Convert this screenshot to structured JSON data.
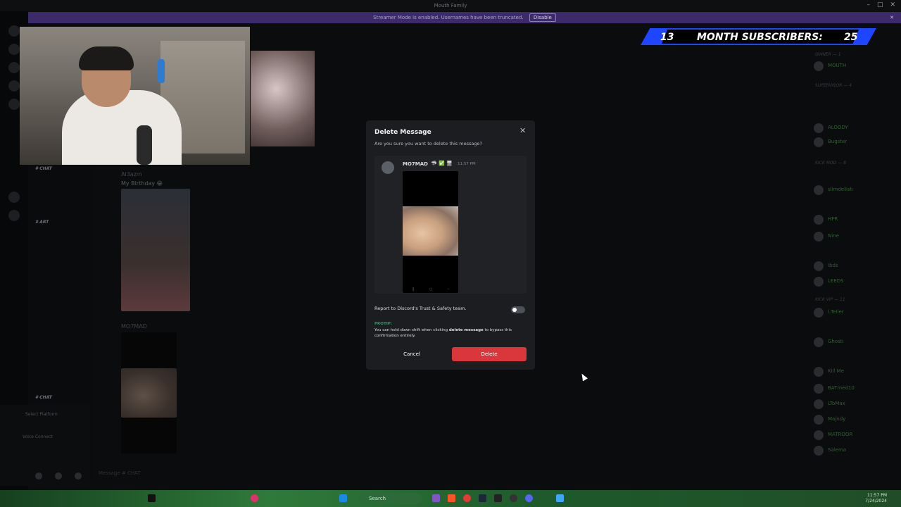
{
  "window": {
    "title": "Mouth Family"
  },
  "banner": {
    "text": "Streamer Mode is enabled. Usernames have been truncated.",
    "disable_label": "Disable",
    "close": "✕"
  },
  "overlay": {
    "left_number": "13",
    "label": "MONTH SUBSCRIBERS:",
    "right_number": "25"
  },
  "channels": [
    {
      "name": "CHAT"
    },
    {
      "name": "ART"
    },
    {
      "name": "CHAT"
    }
  ],
  "chat": {
    "msg1_author": "Al3azm",
    "msg1_text": "My Birthday 😁",
    "msg2_author": "MO7MAD"
  },
  "user_panel": {
    "platform": "Select Platform",
    "voice": "Voice Connect"
  },
  "input": {
    "placeholder": "Message # CHAT"
  },
  "modal": {
    "title": "Delete Message",
    "close_icon": "✕",
    "subtitle": "Are you sure you want to delete this message?",
    "preview": {
      "author": "MO7MAD",
      "badges": "🦈 ✅ 🖥",
      "time": "11:57 PM"
    },
    "report_label": "Report to Discord's Trust & Safety team.",
    "protip_label": "PROTIP:",
    "protip_text_1": "You can hold down shift when clicking ",
    "protip_bold": "delete message",
    "protip_text_2": " to bypass this confirmation entirely.",
    "cancel_label": "Cancel",
    "delete_label": "Delete"
  },
  "members": {
    "roles": [
      "OWNER — 1",
      "SUPERVISOR — 4",
      "KICK MOD — 8",
      "KICK VIP — 11"
    ],
    "names": [
      "MOUTH",
      "ALOODY",
      "Bugster",
      "slimdellah",
      "HFR",
      "Nine",
      "Ibds",
      "LEEDS",
      "l.Teller",
      "Ghosti",
      "Kill Me",
      "BATmed10",
      "LToMax",
      "Majndy",
      "MATROOR",
      "Salema"
    ]
  },
  "taskbar": {
    "search": "Search",
    "time": "11:57 PM",
    "date": "7/24/2024"
  },
  "colors": {
    "accent_delete": "#da373c",
    "protip": "#23a55a",
    "banner": "#3c2a6b",
    "overlay_blue": "#1e45ff"
  }
}
